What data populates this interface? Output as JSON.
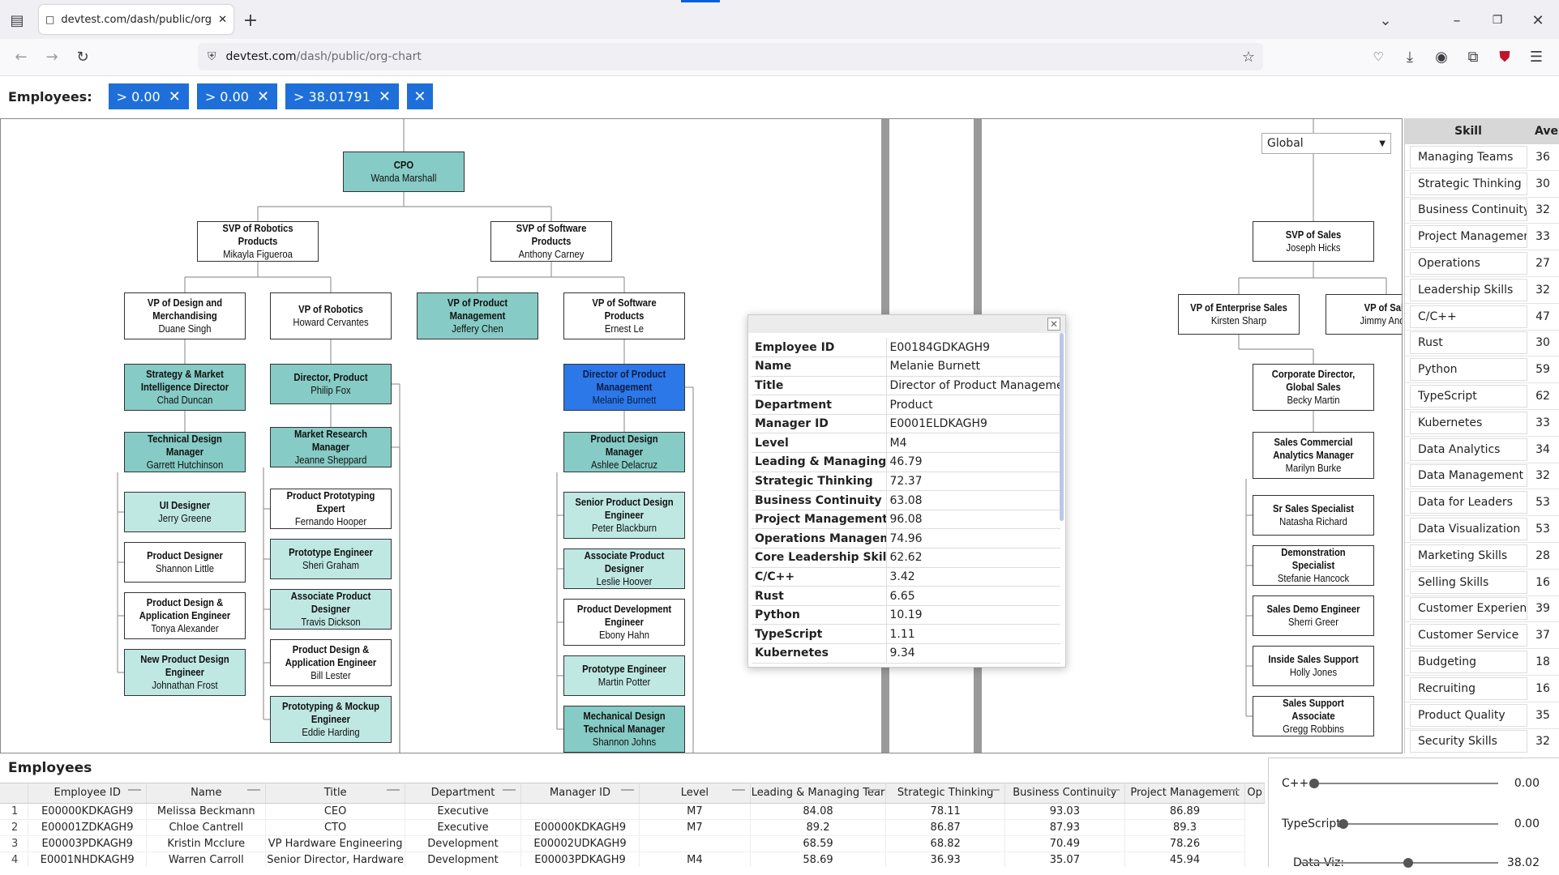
{
  "browser": {
    "tab_title": "devtest.com/dash/public/org-cha",
    "url_host": "devtest.com",
    "url_path": "/dash/public/org-chart"
  },
  "filters": {
    "label": "Employees:",
    "chips": [
      "> 0.00",
      "> 0.00",
      "> 38.01791"
    ]
  },
  "chart": {
    "global_select": "Global",
    "nodes": [
      {
        "title": "CPO",
        "name": "Wanda Marshall",
        "style": "teal"
      },
      {
        "title": "SVP of Robotics Products",
        "name": "Mikayla Figueroa",
        "style": "white"
      },
      {
        "title": "SVP of Software Products",
        "name": "Anthony Carney",
        "style": "white"
      },
      {
        "title": "VP of Design and Merchandising",
        "name": "Duane Singh",
        "style": "white"
      },
      {
        "title": "VP of Robotics",
        "name": "Howard Cervantes",
        "style": "white"
      },
      {
        "title": "VP of Product Management",
        "name": "Jeffery Chen",
        "style": "teal"
      },
      {
        "title": "VP of Software Products",
        "name": "Ernest Le",
        "style": "white"
      },
      {
        "title": "Strategy & Market Intelligence Director",
        "name": "Chad Duncan",
        "style": "teal"
      },
      {
        "title": "Director, Product",
        "name": "Philip Fox",
        "style": "teal"
      },
      {
        "title": "Director of Product Management",
        "name": "Melanie Burnett",
        "style": "blue"
      },
      {
        "title": "Technical Design Manager",
        "name": "Garrett Hutchinson",
        "style": "teal"
      },
      {
        "title": "Market Research Manager",
        "name": "Jeanne Sheppard",
        "style": "teal"
      },
      {
        "title": "Product Design Manager",
        "name": "Ashlee Delacruz",
        "style": "teal"
      },
      {
        "title": "UI Designer",
        "name": "Jerry Greene",
        "style": "light"
      },
      {
        "title": "Product Designer",
        "name": "Shannon Little",
        "style": "white"
      },
      {
        "title": "Product Design & Application Engineer",
        "name": "Tonya Alexander",
        "style": "white"
      },
      {
        "title": "New Product Design Engineer",
        "name": "Johnathan Frost",
        "style": "light"
      },
      {
        "title": "Product Prototyping Expert",
        "name": "Fernando Hooper",
        "style": "white"
      },
      {
        "title": "Prototype Engineer",
        "name": "Sheri Graham",
        "style": "light"
      },
      {
        "title": "Associate Product Designer",
        "name": "Travis Dickson",
        "style": "light"
      },
      {
        "title": "Product Design & Application Engineer",
        "name": "Bill Lester",
        "style": "white"
      },
      {
        "title": "Prototyping & Mockup Engineer",
        "name": "Eddie Harding",
        "style": "light"
      },
      {
        "title": "Senior Product Design Engineer",
        "name": "Peter Blackburn",
        "style": "light"
      },
      {
        "title": "Associate Product Designer",
        "name": "Leslie Hoover",
        "style": "light"
      },
      {
        "title": "Product Development Engineer",
        "name": "Ebony Hahn",
        "style": "white"
      },
      {
        "title": "Prototype Engineer",
        "name": "Martin Potter",
        "style": "light"
      },
      {
        "title": "Mechanical Design Technical Manager",
        "name": "Shannon Johns",
        "style": "teal"
      },
      {
        "title": "SVP of Sales",
        "name": "Joseph Hicks",
        "style": "white"
      },
      {
        "title": "VP of Enterprise Sales",
        "name": "Kirsten Sharp",
        "style": "white"
      },
      {
        "title": "VP of Sale",
        "name": "Jimmy Ander",
        "style": "white"
      },
      {
        "title": "Corporate Director, Global Sales",
        "name": "Becky Martin",
        "style": "white"
      },
      {
        "title": "Sales Commercial Analytics Manager",
        "name": "Marilyn Burke",
        "style": "white"
      },
      {
        "title": "Sr Sales Specialist",
        "name": "Natasha Richard",
        "style": "white"
      },
      {
        "title": "Demonstration Specialist",
        "name": "Stefanie Hancock",
        "style": "white"
      },
      {
        "title": "Sales Demo Engineer",
        "name": "Sherri Greer",
        "style": "white"
      },
      {
        "title": "Inside Sales Support",
        "name": "Holly Jones",
        "style": "white"
      },
      {
        "title": "Sales Support Associate",
        "name": "Gregg Robbins",
        "style": "white"
      }
    ]
  },
  "popup": {
    "rows": [
      {
        "k": "Employee ID",
        "v": "E00184GDKAGH9"
      },
      {
        "k": "Name",
        "v": "Melanie Burnett"
      },
      {
        "k": "Title",
        "v": "Director of Product Management"
      },
      {
        "k": "Department",
        "v": "Product"
      },
      {
        "k": "Manager ID",
        "v": "E0001ELDKAGH9"
      },
      {
        "k": "Level",
        "v": "M4"
      },
      {
        "k": "Leading & Managing Tear",
        "v": "46.79"
      },
      {
        "k": "Strategic Thinking",
        "v": "72.37"
      },
      {
        "k": "Business Continuity",
        "v": "63.08"
      },
      {
        "k": "Project Management",
        "v": "96.08"
      },
      {
        "k": "Operations Management",
        "v": "74.96"
      },
      {
        "k": "Core Leadership Skills",
        "v": "62.62"
      },
      {
        "k": "C/C++",
        "v": "3.42"
      },
      {
        "k": "Rust",
        "v": "6.65"
      },
      {
        "k": "Python",
        "v": "10.19"
      },
      {
        "k": "TypeScript",
        "v": "1.11"
      },
      {
        "k": "Kubernetes",
        "v": "9.34"
      }
    ]
  },
  "skills": {
    "headers": [
      "Skill",
      "Ave"
    ],
    "rows": [
      [
        "Managing Teams",
        "36"
      ],
      [
        "Strategic Thinking",
        "30"
      ],
      [
        "Business Continuity",
        "32"
      ],
      [
        "Project Management",
        "33"
      ],
      [
        "Operations",
        "27"
      ],
      [
        "Leadership Skills",
        "32"
      ],
      [
        "C/C++",
        "47"
      ],
      [
        "Rust",
        "30"
      ],
      [
        "Python",
        "59"
      ],
      [
        "TypeScript",
        "62"
      ],
      [
        "Kubernetes",
        "33"
      ],
      [
        "Data Analytics",
        "34"
      ],
      [
        "Data Management",
        "32"
      ],
      [
        "Data for Leaders",
        "53"
      ],
      [
        "Data Visualization",
        "53"
      ],
      [
        "Marketing Skills",
        "28"
      ],
      [
        "Selling Skills",
        "16"
      ],
      [
        "Customer Experience",
        "39"
      ],
      [
        "Customer Service",
        "37"
      ],
      [
        "Budgeting",
        "18"
      ],
      [
        "Recruiting",
        "16"
      ],
      [
        "Product Quality",
        "35"
      ],
      [
        "Security Skills",
        "32"
      ]
    ]
  },
  "employees": {
    "title": "Employees",
    "headers": [
      "Employee ID",
      "Name",
      "Title",
      "Department",
      "Manager ID",
      "Level",
      "Leading & Managing Tear",
      "Strategic Thinking",
      "Business Continuity",
      "Project Management",
      "Op"
    ],
    "rows": [
      [
        "1",
        "E00000KDKAGH9",
        "Melissa Beckmann",
        "CEO",
        "Executive",
        "",
        "M7",
        "84.08",
        "78.11",
        "93.03",
        "86.89"
      ],
      [
        "2",
        "E00001ZDKAGH9",
        "Chloe Cantrell",
        "CTO",
        "Executive",
        "E00000KDKAGH9",
        "M7",
        "89.2",
        "86.87",
        "87.93",
        "89.3"
      ],
      [
        "3",
        "E00003PDKAGH9",
        "Kristin Mcclure",
        "VP Hardware Engineering",
        "Development",
        "E00002UDKAGH9",
        "",
        "68.59",
        "68.82",
        "70.49",
        "78.26"
      ],
      [
        "4",
        "E0001NHDKAGH9",
        "Warren Carroll",
        "Senior Director, Hardware",
        "Development",
        "E00003PDKAGH9",
        "M4",
        "58.69",
        "36.93",
        "35.07",
        "45.94"
      ]
    ]
  },
  "sliders": [
    {
      "label": "C++:",
      "value": "0.00",
      "level": 0.0
    },
    {
      "label": "TypeScript:",
      "value": "0.00",
      "level": 0.0
    },
    {
      "label": "Data Viz:",
      "value": "38.02",
      "level": 0.38
    }
  ]
}
